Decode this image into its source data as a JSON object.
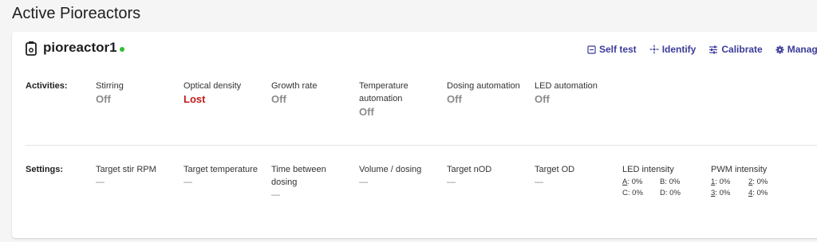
{
  "page_title": "Active Pioreactors",
  "unit": {
    "name": "pioreactor1",
    "status_color": "#2fbe2f"
  },
  "actions": [
    {
      "label": "Self test",
      "icon": "self-test-icon"
    },
    {
      "label": "Identify",
      "icon": "identify-icon"
    },
    {
      "label": "Calibrate",
      "icon": "calibrate-icon"
    },
    {
      "label": "Manage",
      "icon": "gear-icon"
    }
  ],
  "activities": {
    "label": "Activities:",
    "items": [
      {
        "label": "Stirring",
        "value": "Off"
      },
      {
        "label": "Optical density",
        "value": "Lost"
      },
      {
        "label": "Growth rate",
        "value": "Off"
      },
      {
        "label": "Temperature automation",
        "value": "Off"
      },
      {
        "label": "Dosing automation",
        "value": "Off"
      },
      {
        "label": "LED automation",
        "value": "Off"
      }
    ]
  },
  "settings": {
    "label": "Settings:",
    "items": [
      {
        "label": "Target stir RPM",
        "value": "—"
      },
      {
        "label": "Target temperature",
        "value": "—"
      },
      {
        "label": "Time between dosing",
        "value": "—"
      },
      {
        "label": "Volume / dosing",
        "value": "—"
      },
      {
        "label": "Target nOD",
        "value": "—"
      },
      {
        "label": "Target OD",
        "value": "—"
      }
    ],
    "led_intensity": {
      "label": "LED intensity",
      "channels": [
        {
          "ch": "A",
          "val": "0%"
        },
        {
          "ch": "B",
          "val": "0%"
        },
        {
          "ch": "C",
          "val": "0%"
        },
        {
          "ch": "D",
          "val": "0%"
        }
      ]
    },
    "pwm_intensity": {
      "label": "PWM intensity",
      "channels": [
        {
          "ch": "1",
          "val": "0%"
        },
        {
          "ch": "2",
          "val": "0%"
        },
        {
          "ch": "3",
          "val": "0%"
        },
        {
          "ch": "4",
          "val": "0%"
        }
      ]
    }
  },
  "colors": {
    "accent": "#3b3b9a",
    "lost": "#c21b1b",
    "muted": "#8a8a8a"
  }
}
